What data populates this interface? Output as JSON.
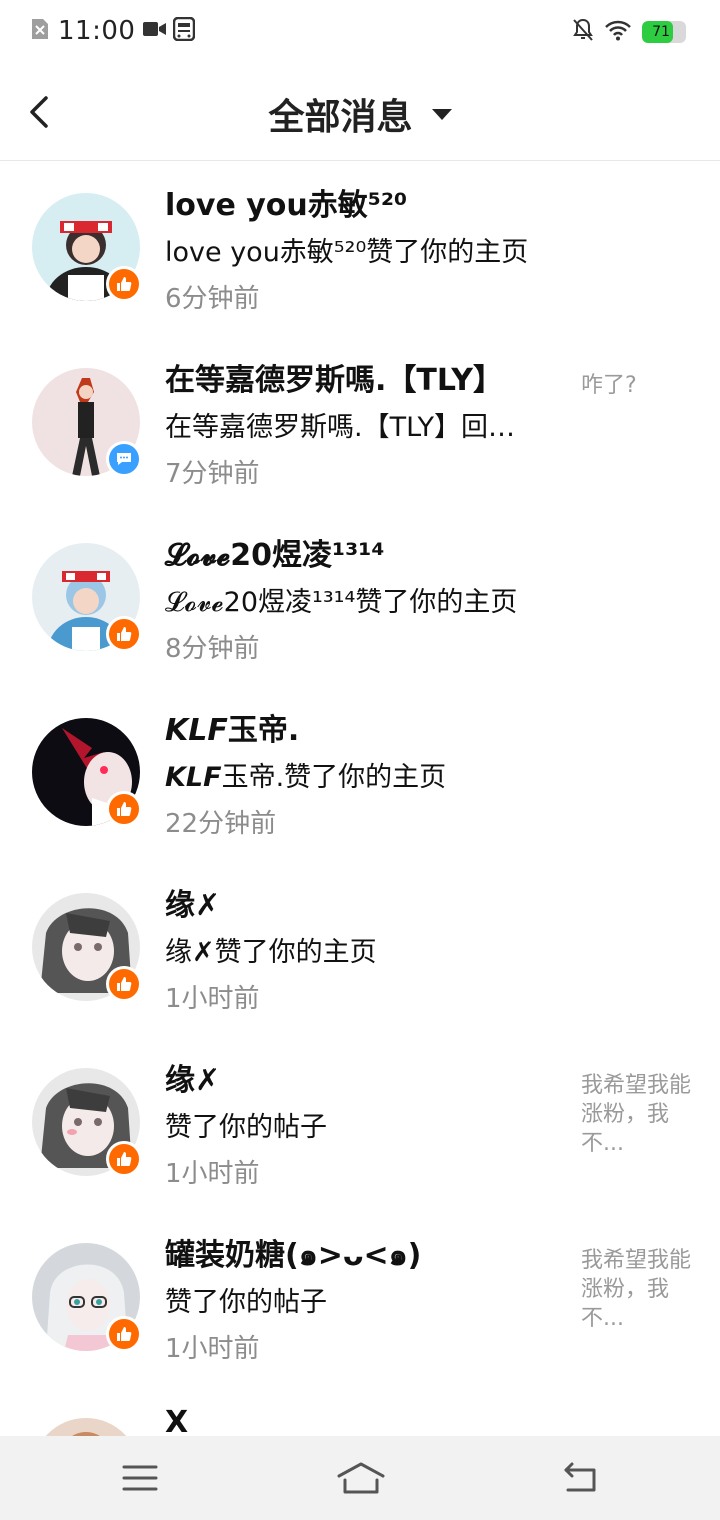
{
  "status_bar": {
    "time": "11:00",
    "battery": "71",
    "battery_level": 0.71
  },
  "header": {
    "title": "全部消息"
  },
  "colors": {
    "like_badge": "#ff6a00",
    "comment_badge": "#3aa0ff",
    "battery_green": "#2ecc40"
  },
  "messages": [
    {
      "name": "love you赤敏⁵²⁰",
      "desc": "love you赤敏⁵²⁰赞了你的主页",
      "time": "6分钟前",
      "preview": "",
      "badge": "like-icon"
    },
    {
      "name": "在等嘉德罗斯嗎.【TLY】",
      "desc": "在等嘉德罗斯嗎.【TLY】回…",
      "time": "7分钟前",
      "preview": "咋了?",
      "badge": "comment-icon"
    },
    {
      "name": "𝓛𝓸𝓿𝓮20煜凌¹³¹⁴",
      "desc": "𝓛𝓸𝓿𝓮20煜凌¹³¹⁴赞了你的主页",
      "time": "8分钟前",
      "preview": "",
      "badge": "like-icon"
    },
    {
      "name": "𝙆𝙇𝙁玉帝.",
      "desc": "𝙆𝙇𝙁玉帝.赞了你的主页",
      "time": "22分钟前",
      "preview": "",
      "badge": "like-icon"
    },
    {
      "name": "缘✗",
      "desc": "缘✗赞了你的主页",
      "time": "1小时前",
      "preview": "",
      "badge": "like-icon"
    },
    {
      "name": "缘✗",
      "desc": "赞了你的帖子",
      "time": "1小时前",
      "preview": "我希望我能涨粉，我不...",
      "badge": "like-icon"
    },
    {
      "name": "罐装奶糖(๑>ᴗ<๑)",
      "desc": "赞了你的帖子",
      "time": "1小时前",
      "preview": "我希望我能涨粉，我不...",
      "badge": "like-icon"
    },
    {
      "name": "X",
      "desc": "",
      "time": "",
      "preview": "",
      "badge": ""
    }
  ]
}
